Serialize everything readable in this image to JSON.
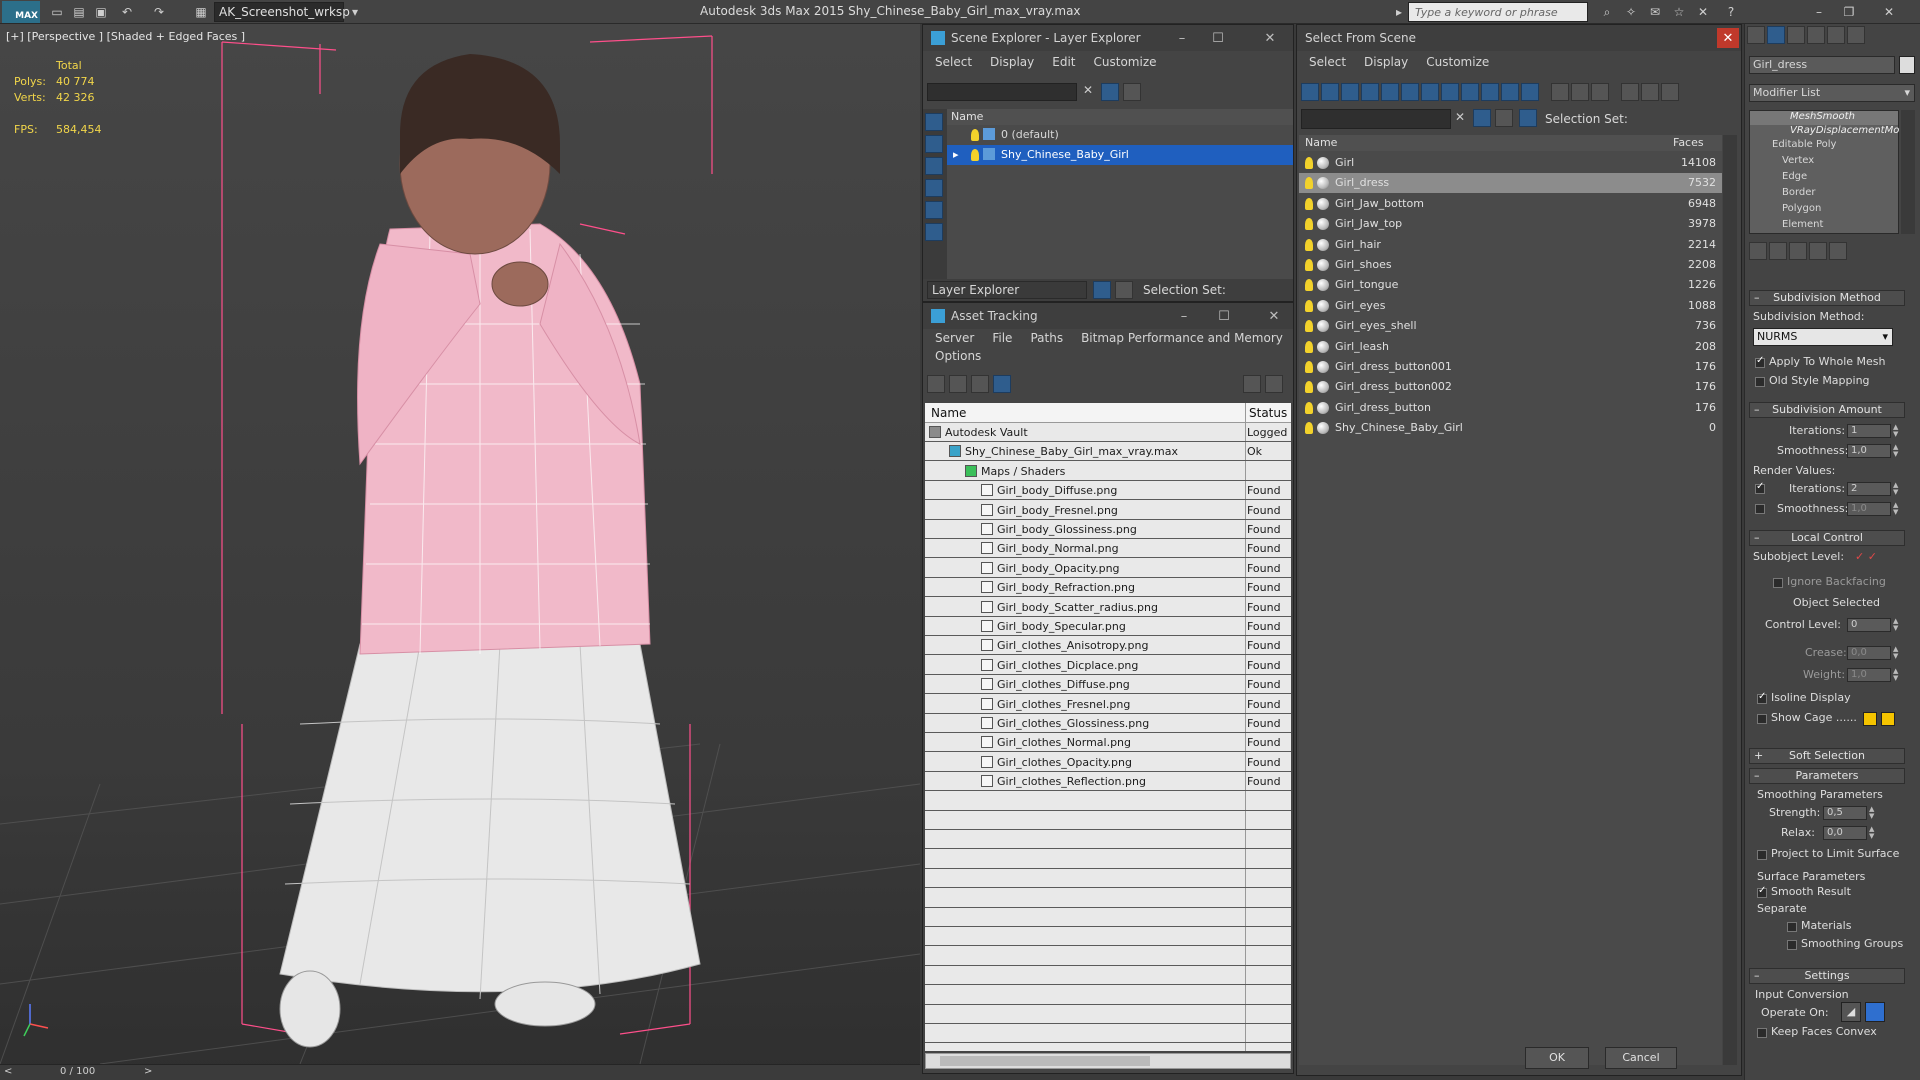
{
  "toolbar": {
    "logo_text": "MAX",
    "workspace_value": "AK_Screenshot_wrksp",
    "app_title": "Autodesk 3ds Max  2015    Shy_Chinese_Baby_Girl_max_vray.max",
    "search_placeholder": "Type a keyword or phrase"
  },
  "viewport": {
    "label": "[+] [Perspective ] [Shaded + Edged Faces ]",
    "stats_total": "Total",
    "polys_label": "Polys:",
    "polys_value": "40 774",
    "verts_label": "Verts:",
    "verts_value": "42 326",
    "fps_label": "FPS:",
    "fps_value": "584,454",
    "timeline": "0 / 100"
  },
  "scene_explorer": {
    "title": "Scene Explorer - Layer Explorer",
    "menu": [
      "Select",
      "Display",
      "Edit",
      "Customize"
    ],
    "col_name": "Name",
    "layers": [
      "0 (default)",
      "Shy_Chinese_Baby_Girl"
    ],
    "footer_dropdown": "Layer Explorer",
    "footer_selection": "Selection Set:"
  },
  "asset_tracking": {
    "title": "Asset Tracking",
    "menu": [
      "Server",
      "File",
      "Paths",
      "Bitmap Performance and Memory"
    ],
    "menu2": "Options",
    "col_name": "Name",
    "col_status": "Status",
    "rows": [
      {
        "name": "Autodesk Vault",
        "status": "Logged",
        "level": 0
      },
      {
        "name": "Shy_Chinese_Baby_Girl_max_vray.max",
        "status": "Ok",
        "level": 1
      },
      {
        "name": "Maps / Shaders",
        "status": "",
        "level": 2
      },
      {
        "name": "Girl_body_Diffuse.png",
        "status": "Found",
        "level": 3
      },
      {
        "name": "Girl_body_Fresnel.png",
        "status": "Found",
        "level": 3
      },
      {
        "name": "Girl_body_Glossiness.png",
        "status": "Found",
        "level": 3
      },
      {
        "name": "Girl_body_Normal.png",
        "status": "Found",
        "level": 3
      },
      {
        "name": "Girl_body_Opacity.png",
        "status": "Found",
        "level": 3
      },
      {
        "name": "Girl_body_Refraction.png",
        "status": "Found",
        "level": 3
      },
      {
        "name": "Girl_body_Scatter_radius.png",
        "status": "Found",
        "level": 3
      },
      {
        "name": "Girl_body_Specular.png",
        "status": "Found",
        "level": 3
      },
      {
        "name": "Girl_clothes_Anisotropy.png",
        "status": "Found",
        "level": 3
      },
      {
        "name": "Girl_clothes_Dicplace.png",
        "status": "Found",
        "level": 3
      },
      {
        "name": "Girl_clothes_Diffuse.png",
        "status": "Found",
        "level": 3
      },
      {
        "name": "Girl_clothes_Fresnel.png",
        "status": "Found",
        "level": 3
      },
      {
        "name": "Girl_clothes_Glossiness.png",
        "status": "Found",
        "level": 3
      },
      {
        "name": "Girl_clothes_Normal.png",
        "status": "Found",
        "level": 3
      },
      {
        "name": "Girl_clothes_Opacity.png",
        "status": "Found",
        "level": 3
      },
      {
        "name": "Girl_clothes_Reflection.png",
        "status": "Found",
        "level": 3
      }
    ]
  },
  "select_from_scene": {
    "title": "Select From Scene",
    "menu": [
      "Select",
      "Display",
      "Customize"
    ],
    "selection_set": "Selection Set:",
    "col_name": "Name",
    "col_faces": "Faces",
    "rows": [
      {
        "name": "Girl",
        "faces": "14108"
      },
      {
        "name": "Girl_dress",
        "faces": "7532"
      },
      {
        "name": "Girl_Jaw_bottom",
        "faces": "6948"
      },
      {
        "name": "Girl_Jaw_top",
        "faces": "3978"
      },
      {
        "name": "Girl_hair",
        "faces": "2214"
      },
      {
        "name": "Girl_shoes",
        "faces": "2208"
      },
      {
        "name": "Girl_tongue",
        "faces": "1226"
      },
      {
        "name": "Girl_eyes",
        "faces": "1088"
      },
      {
        "name": "Girl_eyes_shell",
        "faces": "736"
      },
      {
        "name": "Girl_leash",
        "faces": "208"
      },
      {
        "name": "Girl_dress_button001",
        "faces": "176"
      },
      {
        "name": "Girl_dress_button002",
        "faces": "176"
      },
      {
        "name": "Girl_dress_button",
        "faces": "176"
      },
      {
        "name": "Shy_Chinese_Baby_Girl",
        "faces": "0"
      }
    ],
    "ok_label": "OK",
    "cancel_label": "Cancel"
  },
  "command_panel": {
    "object_name": "Girl_dress",
    "modifier_list": "Modifier List",
    "stack": [
      "MeshSmooth",
      "VRayDisplacementMo",
      "Editable Poly",
      "Vertex",
      "Edge",
      "Border",
      "Polygon",
      "Element"
    ],
    "subdivision_method_title": "Subdivision Method",
    "subdivision_method_label": "Subdivision Method:",
    "subdivision_method_value": "NURMS",
    "apply_whole_mesh": "Apply To Whole Mesh",
    "old_style_mapping": "Old Style Mapping",
    "subdivision_amount_title": "Subdivision Amount",
    "iterations_label": "Iterations:",
    "iterations_value": "1",
    "smoothness_label": "Smoothness:",
    "smoothness_value": "1,0",
    "render_values": "Render Values:",
    "render_iterations_value": "2",
    "render_smoothness_value": "1,0",
    "local_control_title": "Local Control",
    "subobject_level": "Subobject Level:",
    "ignore_backfacing": "Ignore Backfacing",
    "object_selected": "Object Selected",
    "control_level_label": "Control Level:",
    "control_level_value": "0",
    "crease_label": "Crease:",
    "crease_value": "0,0",
    "weight_label": "Weight:",
    "weight_value": "1,0",
    "isoline_display": "Isoline Display",
    "show_cage": "Show Cage ......",
    "soft_selection_title": "Soft Selection",
    "parameters_title": "Parameters",
    "smoothing_parameters": "Smoothing Parameters",
    "strength_label": "Strength:",
    "strength_value": "0,5",
    "relax_label": "Relax:",
    "relax_value": "0,0",
    "project_limit": "Project to Limit Surface",
    "surface_parameters": "Surface Parameters",
    "smooth_result": "Smooth Result",
    "separate": "Separate",
    "materials": "Materials",
    "smoothing_groups": "Smoothing Groups",
    "settings_title": "Settings",
    "input_conversion": "Input Conversion",
    "operate_on": "Operate On:",
    "keep_faces_convex": "Keep Faces Convex"
  },
  "colors": {
    "selection_blue": "#1f5fbf",
    "highlight_row": "#8c8c8c",
    "stats_yellow": "#f2d64a",
    "cage_yellow": "#f5c400"
  }
}
